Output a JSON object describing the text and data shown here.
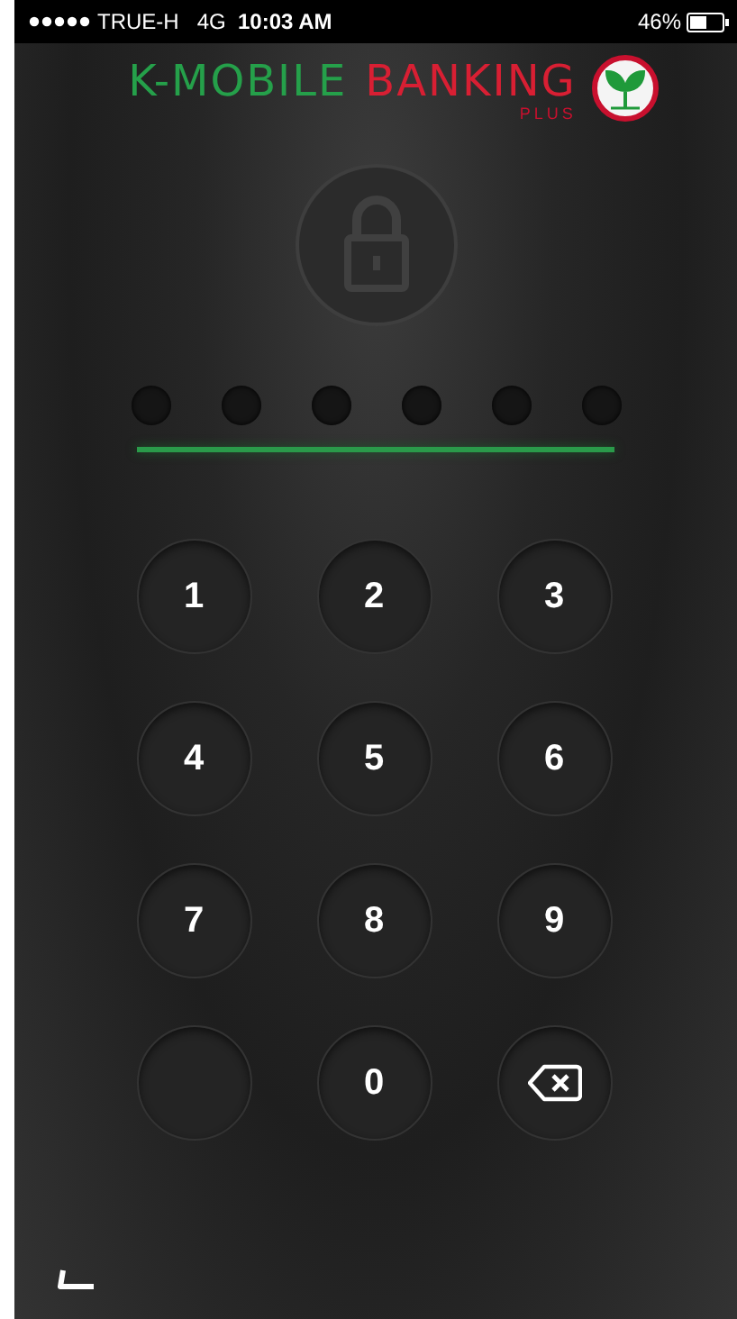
{
  "status_bar": {
    "carrier": "TRUE-H",
    "network": "4G",
    "time": "10:03 AM",
    "battery": "46%"
  },
  "header": {
    "logo_part_1": "K-MOBILE",
    "logo_part_2": "BANKING",
    "logo_sub": "PLUS"
  },
  "pin_dots": [
    {
      "filled": false
    },
    {
      "filled": false
    },
    {
      "filled": false
    },
    {
      "filled": false
    },
    {
      "filled": false
    },
    {
      "filled": false
    }
  ],
  "keypad": [
    {
      "kind": "digit",
      "label": "1"
    },
    {
      "kind": "digit",
      "label": "2"
    },
    {
      "kind": "digit",
      "label": "3"
    },
    {
      "kind": "digit",
      "label": "4"
    },
    {
      "kind": "digit",
      "label": "5"
    },
    {
      "kind": "digit",
      "label": "6"
    },
    {
      "kind": "digit",
      "label": "7"
    },
    {
      "kind": "digit",
      "label": "8"
    },
    {
      "kind": "digit",
      "label": "9"
    },
    {
      "kind": "blank"
    },
    {
      "kind": "digit",
      "label": "0"
    },
    {
      "kind": "backspace"
    }
  ]
}
